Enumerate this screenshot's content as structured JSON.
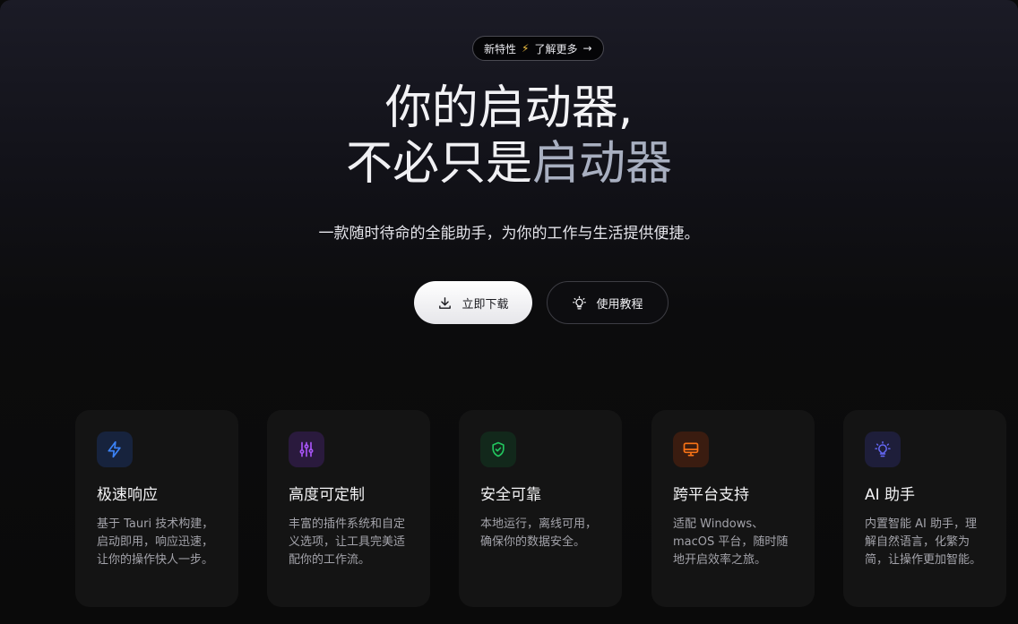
{
  "badge": {
    "text": "新特性",
    "link": "了解更多"
  },
  "hero": {
    "title_line1": "你的启动器,",
    "title_line2_a": "不必只是",
    "title_line2_b": "启动器",
    "subtitle": "一款随时待命的全能助手，为你的工作与生活提供便捷。"
  },
  "buttons": {
    "download": "立即下载",
    "tutorial": "使用教程"
  },
  "features": [
    {
      "title": "极速响应",
      "desc": "基于 Tauri 技术构建，启动即用，响应迅速，让你的操作快人一步。",
      "icon": "bolt-icon",
      "color": "#3b82f6"
    },
    {
      "title": "高度可定制",
      "desc": "丰富的插件系统和自定义选项，让工具完美适配你的工作流。",
      "icon": "sliders-icon",
      "color": "#a855f7"
    },
    {
      "title": "安全可靠",
      "desc": "本地运行，离线可用，确保你的数据安全。",
      "icon": "shield-check-icon",
      "color": "#22c55e"
    },
    {
      "title": "跨平台支持",
      "desc": "适配 Windows、macOS 平台，随时随地开启效率之旅。",
      "icon": "monitor-icon",
      "color": "#f97316"
    },
    {
      "title": "AI 助手",
      "desc": "内置智能 AI 助手，理解自然语言，化繁为简，让操作更加智能。",
      "icon": "lightbulb-icon",
      "color": "#6366f1"
    }
  ]
}
